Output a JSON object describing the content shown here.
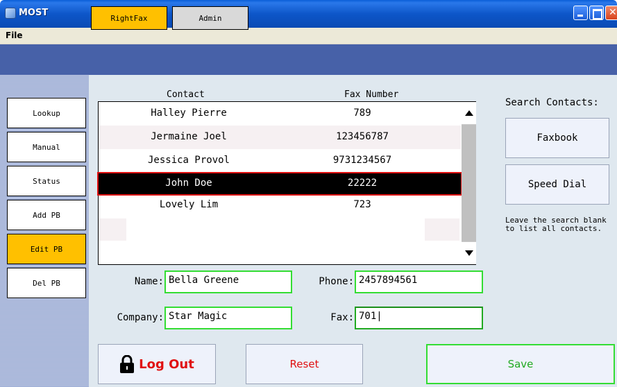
{
  "window": {
    "title": "MOST"
  },
  "menu": {
    "file": "File"
  },
  "tabs": [
    {
      "label": "RightFax",
      "active": true
    },
    {
      "label": "Admin",
      "active": false
    }
  ],
  "sidebar": {
    "items": [
      {
        "label": "Lookup"
      },
      {
        "label": "Manual"
      },
      {
        "label": "Status"
      },
      {
        "label": "Add PB"
      },
      {
        "label": "Edit PB"
      },
      {
        "label": "Del PB"
      }
    ]
  },
  "contacts": {
    "header_contact": "Contact",
    "header_fax": "Fax Number",
    "rows": [
      {
        "name": "Halley Pierre",
        "fax": "789"
      },
      {
        "name": "Jermaine Joel",
        "fax": "123456787"
      },
      {
        "name": "Jessica Provol",
        "fax": "9731234567"
      },
      {
        "name": "John Doe",
        "fax": "22222"
      },
      {
        "name": "Lovely Lim",
        "fax": "723"
      }
    ],
    "selected_index": 3
  },
  "search": {
    "label": "Search Contacts:",
    "faxbook": "Faxbook",
    "speed_dial": "Speed Dial",
    "hint": "Leave the search blank to list all contacts."
  },
  "form": {
    "name_label": "Name:",
    "name_value": "Bella Greene",
    "phone_label": "Phone:",
    "phone_value": "2457894561",
    "company_label": "Company:",
    "company_value": "Star Magic",
    "fax_label": "Fax:",
    "fax_value": "701|"
  },
  "actions": {
    "logout": "Log Out",
    "reset": "Reset",
    "save": "Save"
  },
  "colors": {
    "accent_yellow": "#ffc000",
    "header_blue": "#4761a8",
    "selected_bg": "#000000",
    "selected_outline": "#e01010",
    "field_border": "#33dd33",
    "logout_text": "#e01010",
    "save_text": "#22aa22"
  },
  "icons": {
    "logout": "lock-icon",
    "scroll_up": "triangle-up-icon",
    "scroll_down": "triangle-down-icon"
  }
}
